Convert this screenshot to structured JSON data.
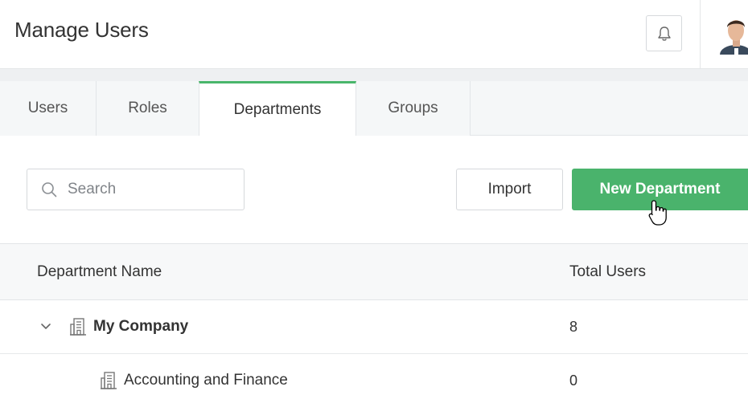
{
  "header": {
    "title": "Manage Users",
    "bell_icon": "bell-icon",
    "avatar_icon": "user-avatar"
  },
  "tabs": [
    {
      "label": "Users",
      "active": false
    },
    {
      "label": "Roles",
      "active": false
    },
    {
      "label": "Departments",
      "active": true
    },
    {
      "label": "Groups",
      "active": false
    }
  ],
  "toolbar": {
    "search_placeholder": "Search",
    "search_value": "",
    "import_label": "Import",
    "new_label": "New Department"
  },
  "table": {
    "columns": [
      "Department Name",
      "Total Users"
    ],
    "rows": [
      {
        "name": "My Company",
        "total_users": "8",
        "expanded": true,
        "level": 0
      },
      {
        "name": "Accounting and Finance",
        "total_users": "0",
        "expanded": false,
        "level": 1
      }
    ]
  },
  "colors": {
    "accent_green": "#4ab36c",
    "active_tab_border": "#49b66b"
  }
}
